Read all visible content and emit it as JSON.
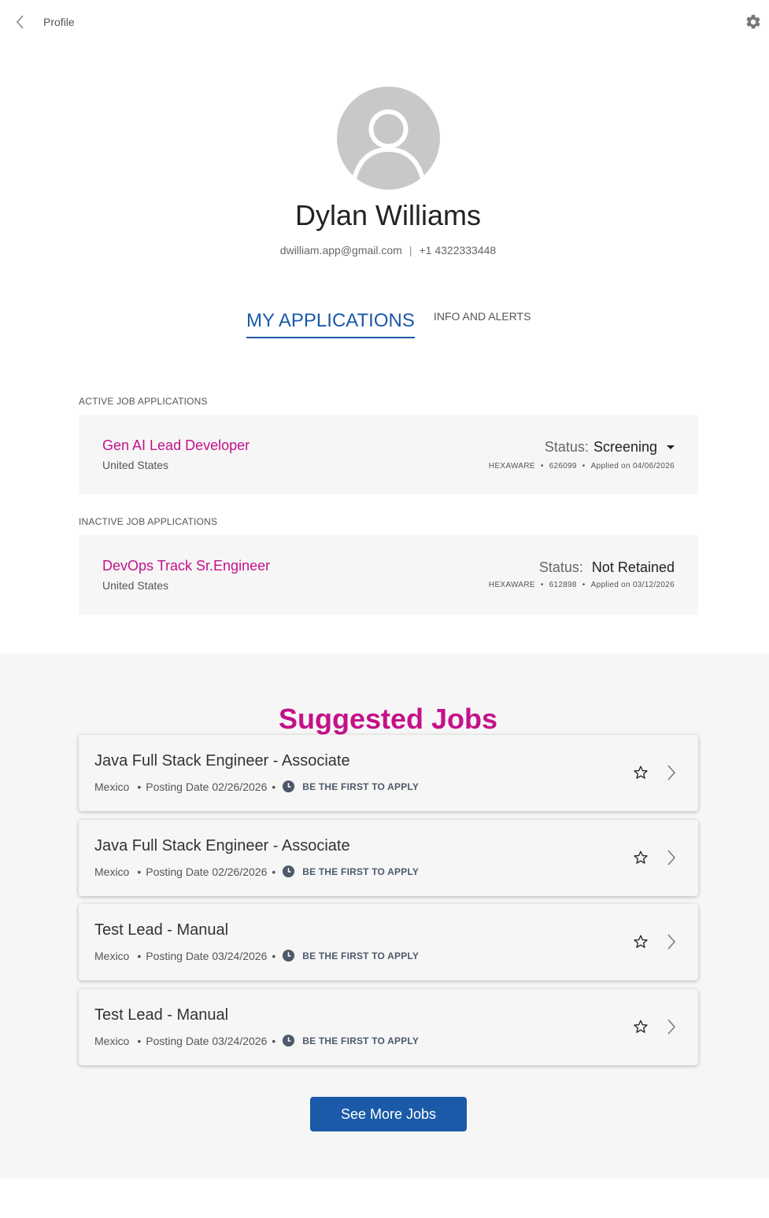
{
  "topbar": {
    "title": "Profile"
  },
  "profile": {
    "name": "Dylan Williams",
    "email": "dwilliam.app@gmail.com",
    "separator": "|",
    "phone": "+1 4322333448"
  },
  "tabs": [
    {
      "label": "MY APPLICATIONS",
      "active": true
    },
    {
      "label": "INFO AND ALERTS",
      "active": false
    }
  ],
  "active_applications": {
    "label": "ACTIVE JOB APPLICATIONS",
    "items": [
      {
        "title": "Gen AI Lead Developer",
        "location": "United States",
        "status_key": "Status:",
        "status": "Screening",
        "company": "HEXAWARE",
        "job_id": "626099",
        "applied": "Applied on 04/06/2026"
      }
    ]
  },
  "inactive_applications": {
    "label": "INACTIVE JOB APPLICATIONS",
    "items": [
      {
        "title": "DevOps Track Sr.Engineer",
        "location": "United States",
        "status_key": "Status:",
        "status": "Not Retained",
        "company": "HEXAWARE",
        "job_id": "612898",
        "applied": "Applied on 03/12/2026"
      }
    ]
  },
  "suggested": {
    "title": "Suggested Jobs",
    "jobs": [
      {
        "title": "Java Full Stack Engineer - Associate",
        "location": "Mexico",
        "posting": "Posting Date 02/26/2026",
        "badge": "BE THE FIRST TO APPLY"
      },
      {
        "title": "Java Full Stack Engineer - Associate",
        "location": "Mexico",
        "posting": "Posting Date 02/26/2026",
        "badge": "BE THE FIRST TO APPLY"
      },
      {
        "title": "Test Lead - Manual",
        "location": "Mexico",
        "posting": "Posting Date 03/24/2026",
        "badge": "BE THE FIRST TO APPLY"
      },
      {
        "title": "Test Lead - Manual",
        "location": "Mexico",
        "posting": "Posting Date 03/24/2026",
        "badge": "BE THE FIRST TO APPLY"
      }
    ],
    "see_more_label": "See More Jobs"
  },
  "icons": {
    "back": "chevron-left-icon",
    "settings": "gear-icon",
    "avatar": "user-placeholder-icon",
    "dropdown": "caret-down-icon",
    "clock": "clock-icon",
    "favorite": "star-outline-icon",
    "open": "chevron-right-icon"
  },
  "colors": {
    "accent_blue": "#1a5aa8",
    "brand_magenta": "#c4118a",
    "card_background": "#f6f6f6",
    "avatar_gray": "#c8c8c8"
  }
}
